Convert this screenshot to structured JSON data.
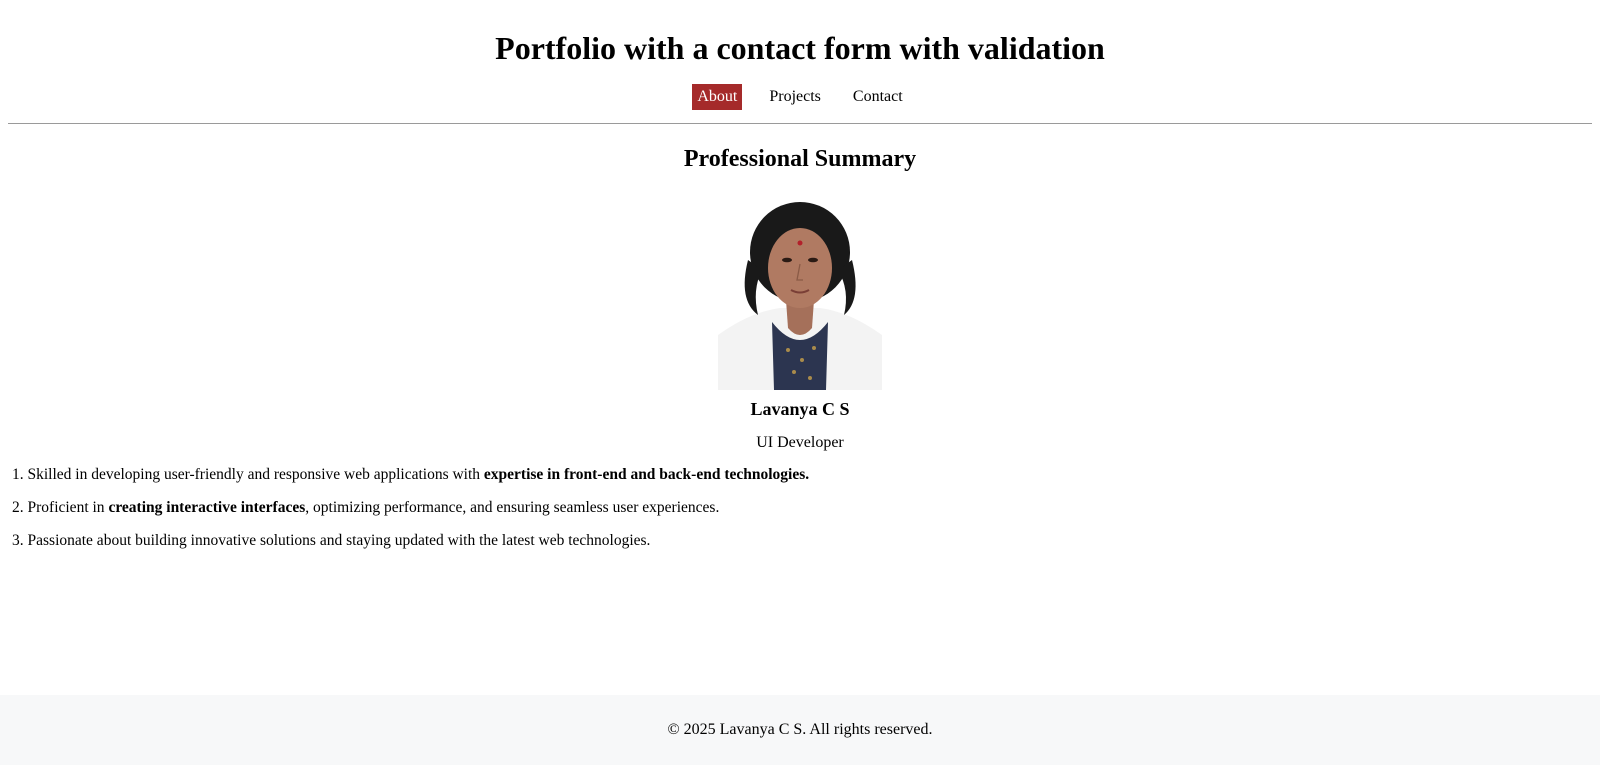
{
  "header": {
    "title": "Portfolio with a contact form with validation"
  },
  "nav": {
    "items": [
      {
        "label": "About",
        "active": true
      },
      {
        "label": "Projects",
        "active": false
      },
      {
        "label": "Contact",
        "active": false
      }
    ]
  },
  "about": {
    "section_title": "Professional Summary",
    "photo_icon": "profile-photo",
    "name": "Lavanya C S",
    "role": "UI Developer",
    "points": [
      {
        "prefix": "1. Skilled in developing user-friendly and responsive web applications with ",
        "bold": "expertise in front-end and back-end technologies.",
        "suffix": ""
      },
      {
        "prefix": "2. Proficient in ",
        "bold": "creating interactive interfaces",
        "suffix": ", optimizing performance, and ensuring seamless user experiences."
      },
      {
        "prefix": "3. Passionate about building innovative solutions and staying updated with the latest web technologies.",
        "bold": "",
        "suffix": ""
      }
    ]
  },
  "footer": {
    "text": "© 2025 Lavanya C S. All rights reserved."
  },
  "colors": {
    "nav_active_bg": "#a52a2a",
    "footer_bg": "#f7f8f9"
  }
}
